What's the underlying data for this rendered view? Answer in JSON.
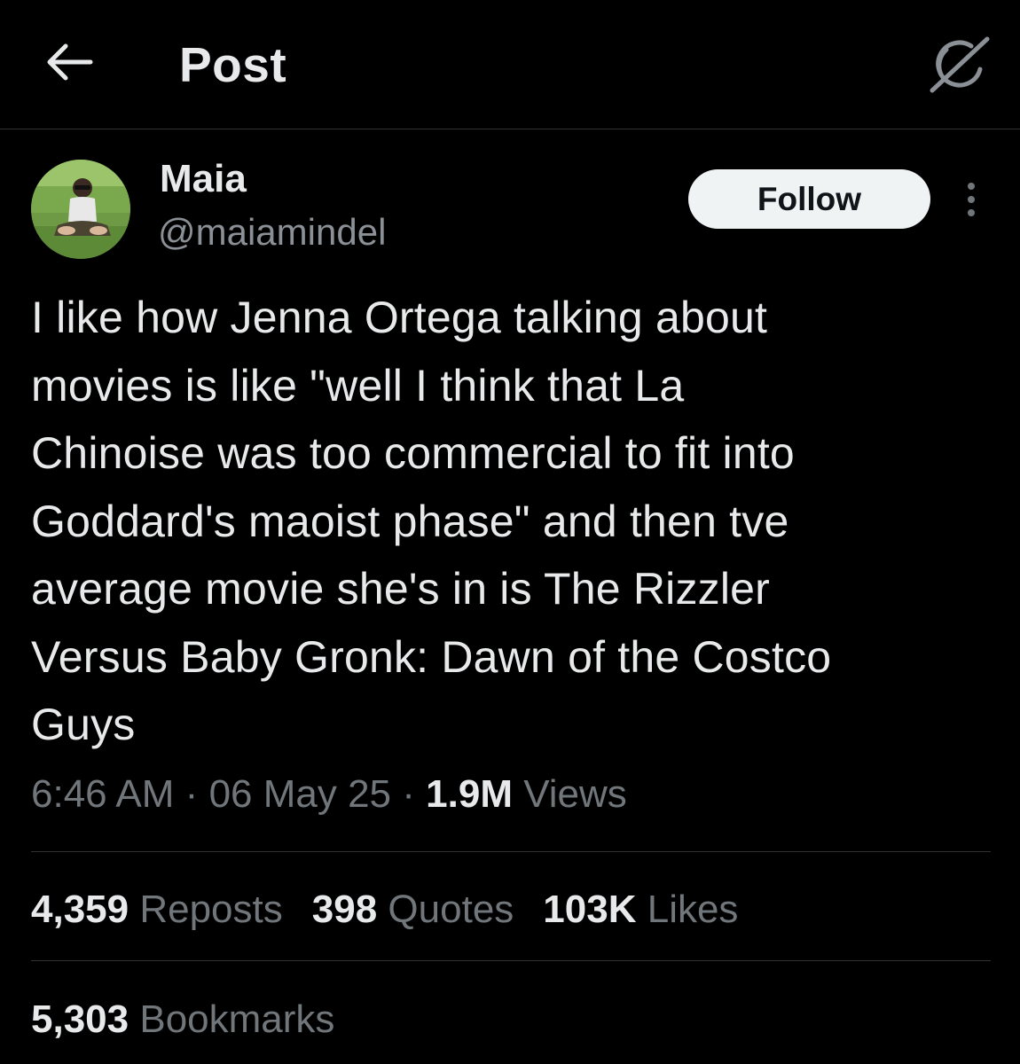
{
  "header": {
    "back_icon": "arrow-left-icon",
    "title": "Post",
    "grok_icon": "grok-icon"
  },
  "author": {
    "display_name": "Maia",
    "handle": "@maiamindel",
    "follow_label": "Follow",
    "more_icon": "more-vertical-icon"
  },
  "tweet": {
    "lines": [
      "I like how Jenna Ortega talking about",
      "movies is like \"well I think that La",
      "Chinoise was too commercial to fit into",
      "Goddard's maoist phase\" and then tve",
      "average movie she's in is The Rizzler",
      "Versus Baby Gronk: Dawn of the Costco",
      "Guys"
    ]
  },
  "meta": {
    "time": "6:46 AM",
    "separator": "·",
    "date": "06 May 25",
    "views_count": "1.9M",
    "views_label": "Views"
  },
  "stats": {
    "reposts_count": "4,359",
    "reposts_label": "Reposts",
    "quotes_count": "398",
    "quotes_label": "Quotes",
    "likes_count": "103K",
    "likes_label": "Likes",
    "bookmarks_count": "5,303",
    "bookmarks_label": "Bookmarks"
  },
  "colors": {
    "background": "#000000",
    "text_primary": "#e7e9ea",
    "text_secondary": "#71767b",
    "divider": "#2f3336",
    "follow_bg": "#eff3f4",
    "follow_text": "#0f1419"
  }
}
